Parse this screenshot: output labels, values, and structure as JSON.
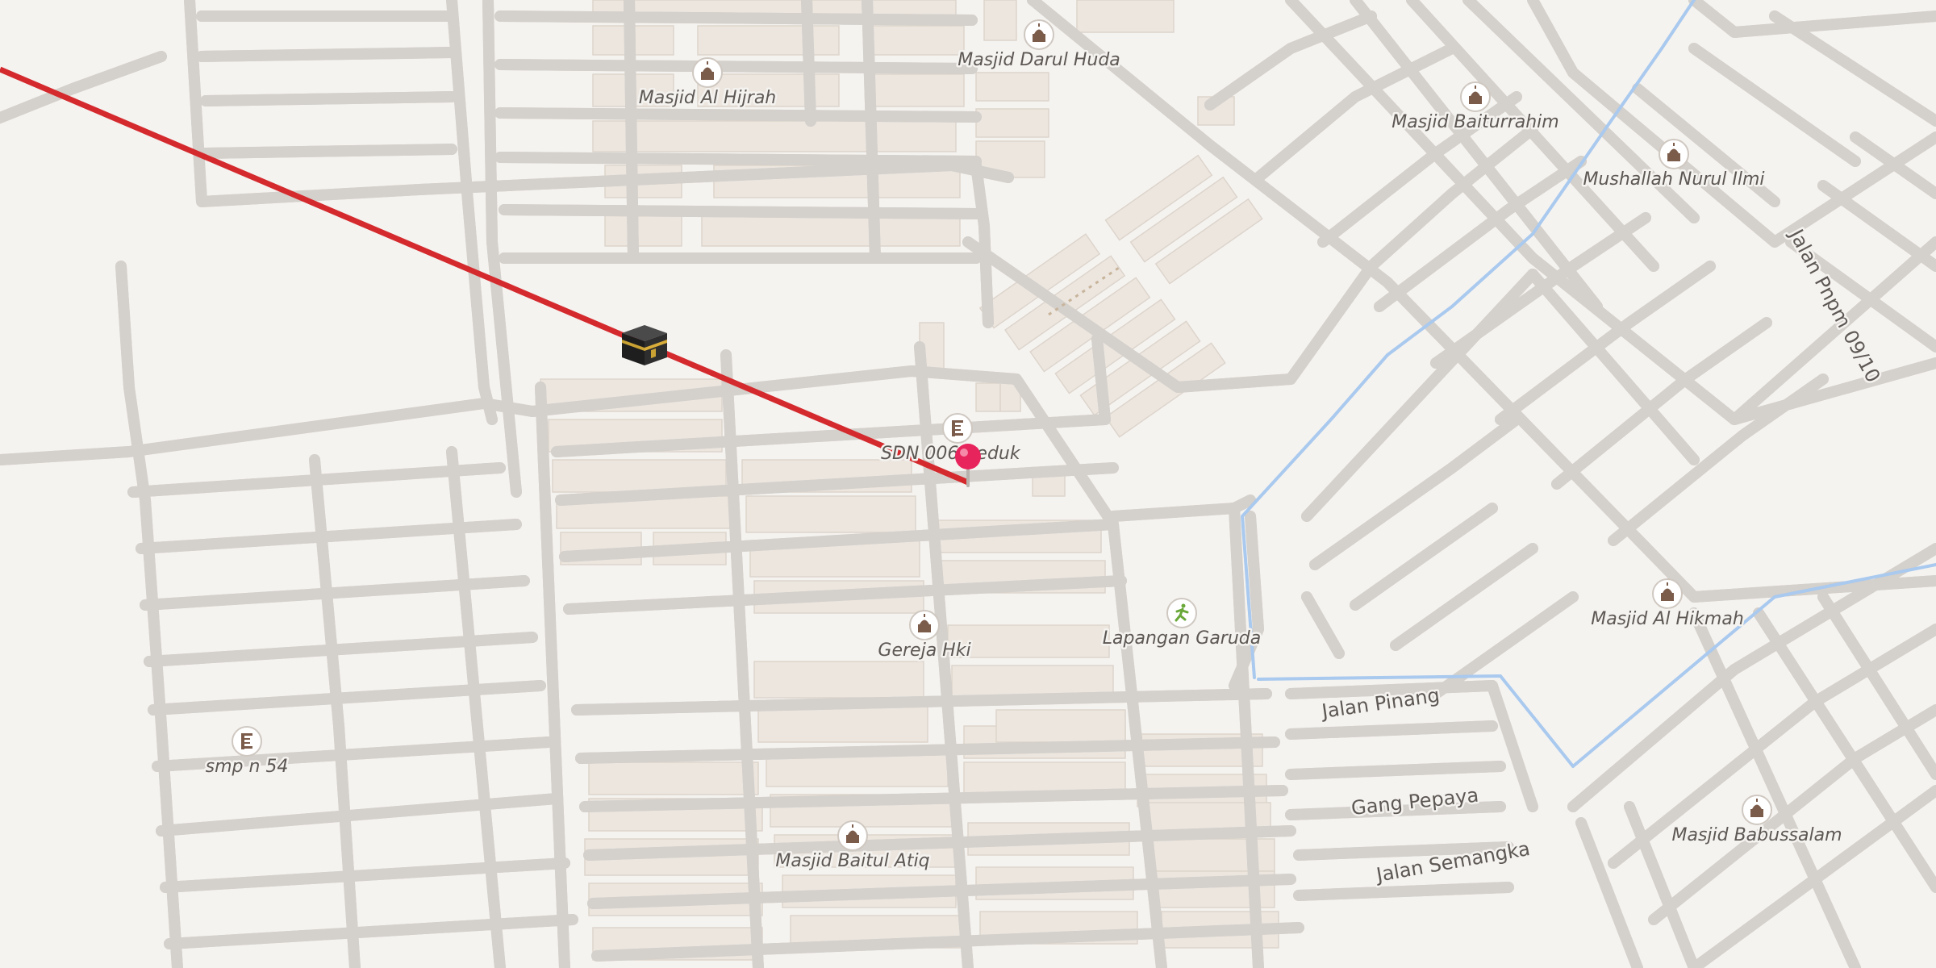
{
  "map": {
    "colors": {
      "background": "#f5f3f0",
      "road": "#ffffff",
      "road_casing": "#d4d0cb",
      "building": "#ece6df",
      "water": "#a9c9ee",
      "qibla_line": "#d42a2e",
      "pin": "#e8245c",
      "label": "#5d5854"
    },
    "pois": [
      {
        "label": "Masjid Darul Huda",
        "icon": "mosque-icon"
      },
      {
        "label": "Masjid Al Hijrah",
        "icon": "mosque-icon"
      },
      {
        "label": "Masjid Baiturrahim",
        "icon": "mosque-icon"
      },
      {
        "label": "Mushallah Nurul Ilmi",
        "icon": "mosque-icon"
      },
      {
        "label": "SDN 006 Beduk",
        "icon": "school-icon"
      },
      {
        "label": "Gereja Hki",
        "icon": "church-icon"
      },
      {
        "label": "Lapangan Garuda",
        "icon": "sports-field-icon"
      },
      {
        "label": "Masjid Al Hikmah",
        "icon": "mosque-icon"
      },
      {
        "label": "smp n 54",
        "icon": "school-icon"
      },
      {
        "label": "Masjid Baitul Atiq",
        "icon": "mosque-icon"
      },
      {
        "label": "Masjid Babussalam",
        "icon": "mosque-icon"
      }
    ],
    "streets": [
      {
        "label": "Jalan Pnpm 09/10"
      },
      {
        "label": "Jalan Pinang"
      },
      {
        "label": "Gang Pepaya"
      },
      {
        "label": "Jalan Semangka"
      }
    ],
    "qibla_marker": {
      "icon": "kaaba-icon"
    },
    "location_pin": {
      "icon": "location-pin-icon"
    }
  }
}
